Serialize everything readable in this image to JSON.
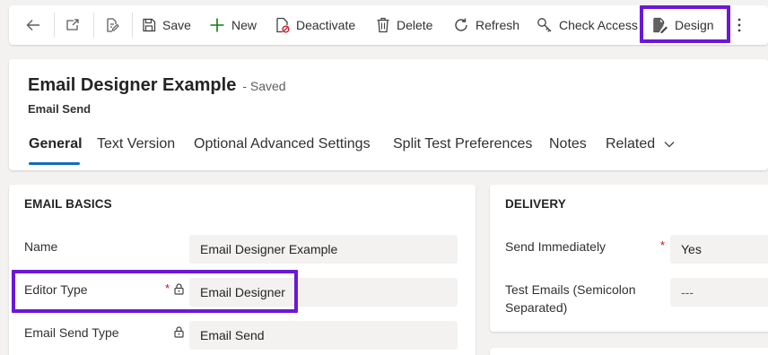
{
  "toolbar": {
    "back_icon": "back-arrow-icon",
    "save_label": "Save",
    "new_label": "New",
    "deactivate_label": "Deactivate",
    "delete_label": "Delete",
    "refresh_label": "Refresh",
    "check_access_label": "Check Access",
    "design_label": "Design",
    "more_icon": "more-vertical-icon"
  },
  "header": {
    "title": "Email Designer Example",
    "saved_state": "- Saved",
    "entity_name": "Email Send"
  },
  "tabs": [
    {
      "label": "General",
      "active": true
    },
    {
      "label": "Text Version"
    },
    {
      "label": "Optional Advanced Settings"
    },
    {
      "label": "Split Test Preferences"
    },
    {
      "label": "Notes"
    },
    {
      "label": "Related"
    }
  ],
  "email_basics": {
    "title": "EMAIL BASICS",
    "name_label": "Name",
    "name_value": "Email Designer Example",
    "editor_type_label": "Editor Type",
    "editor_type_required": "*",
    "editor_type_value": "Email Designer",
    "email_send_type_label": "Email Send Type",
    "email_send_type_value": "Email Send"
  },
  "delivery": {
    "title": "DELIVERY",
    "send_immediately_label": "Send Immediately",
    "send_immediately_required": "*",
    "send_immediately_value": "Yes",
    "test_emails_label_line1": "Test Emails (Semicolon",
    "test_emails_label_line2": "Separated)",
    "test_emails_value": "---"
  },
  "colors": {
    "highlight": "#6b18d6",
    "accent": "#0f6cbd",
    "new_icon": "#107c10",
    "required": "#c50f1f"
  }
}
